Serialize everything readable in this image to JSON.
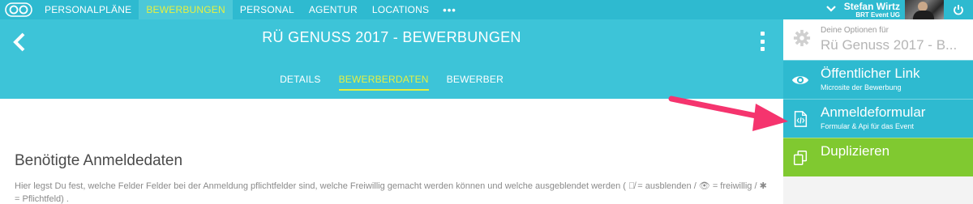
{
  "nav": {
    "items": [
      {
        "label": "PERSONALPLÄNE",
        "active": false
      },
      {
        "label": "BEWERBUNGEN",
        "active": true
      },
      {
        "label": "PERSONAL",
        "active": false
      },
      {
        "label": "AGENTUR",
        "active": false
      },
      {
        "label": "LOCATIONS",
        "active": false
      }
    ],
    "more": "•••"
  },
  "user": {
    "name": "Stefan Wirtz",
    "company": "BRT Event UG"
  },
  "header": {
    "title": "RÜ GENUSS 2017 - BEWERBUNGEN",
    "tabs": [
      {
        "label": "DETAILS",
        "active": false
      },
      {
        "label": "BEWERBERDATEN",
        "active": true
      },
      {
        "label": "BEWERBER",
        "active": false
      }
    ]
  },
  "content": {
    "heading": "Benötigte Anmeldedaten",
    "description": "Hier legst Du fest, welche Felder Felder bei der Anmeldung pflichtfelder sind, welche Freiwillig gemacht werden können und welche ausgeblendet werden ( 👁̸ = ausblenden / 👁 = freiwillig / ✱ = Pflichtfeld) ."
  },
  "panel": {
    "small": "Deine Optionen für",
    "big": "Rü Genuss 2017 - B...",
    "options": [
      {
        "label": "Öffentlicher Link",
        "sub": "Microsite der Bewerbung",
        "icon": "eye-icon"
      },
      {
        "label": "Anmeldeformular",
        "sub": "Formular & Api für das Event",
        "icon": "code-file-icon"
      },
      {
        "label": "Duplizieren",
        "sub": "",
        "icon": "duplicate-icon"
      }
    ]
  },
  "colors": {
    "primary": "#2ebad0",
    "header": "#3dc4d8",
    "accent": "#e6f040",
    "green": "#80c930",
    "arrow": "#f5346e"
  }
}
